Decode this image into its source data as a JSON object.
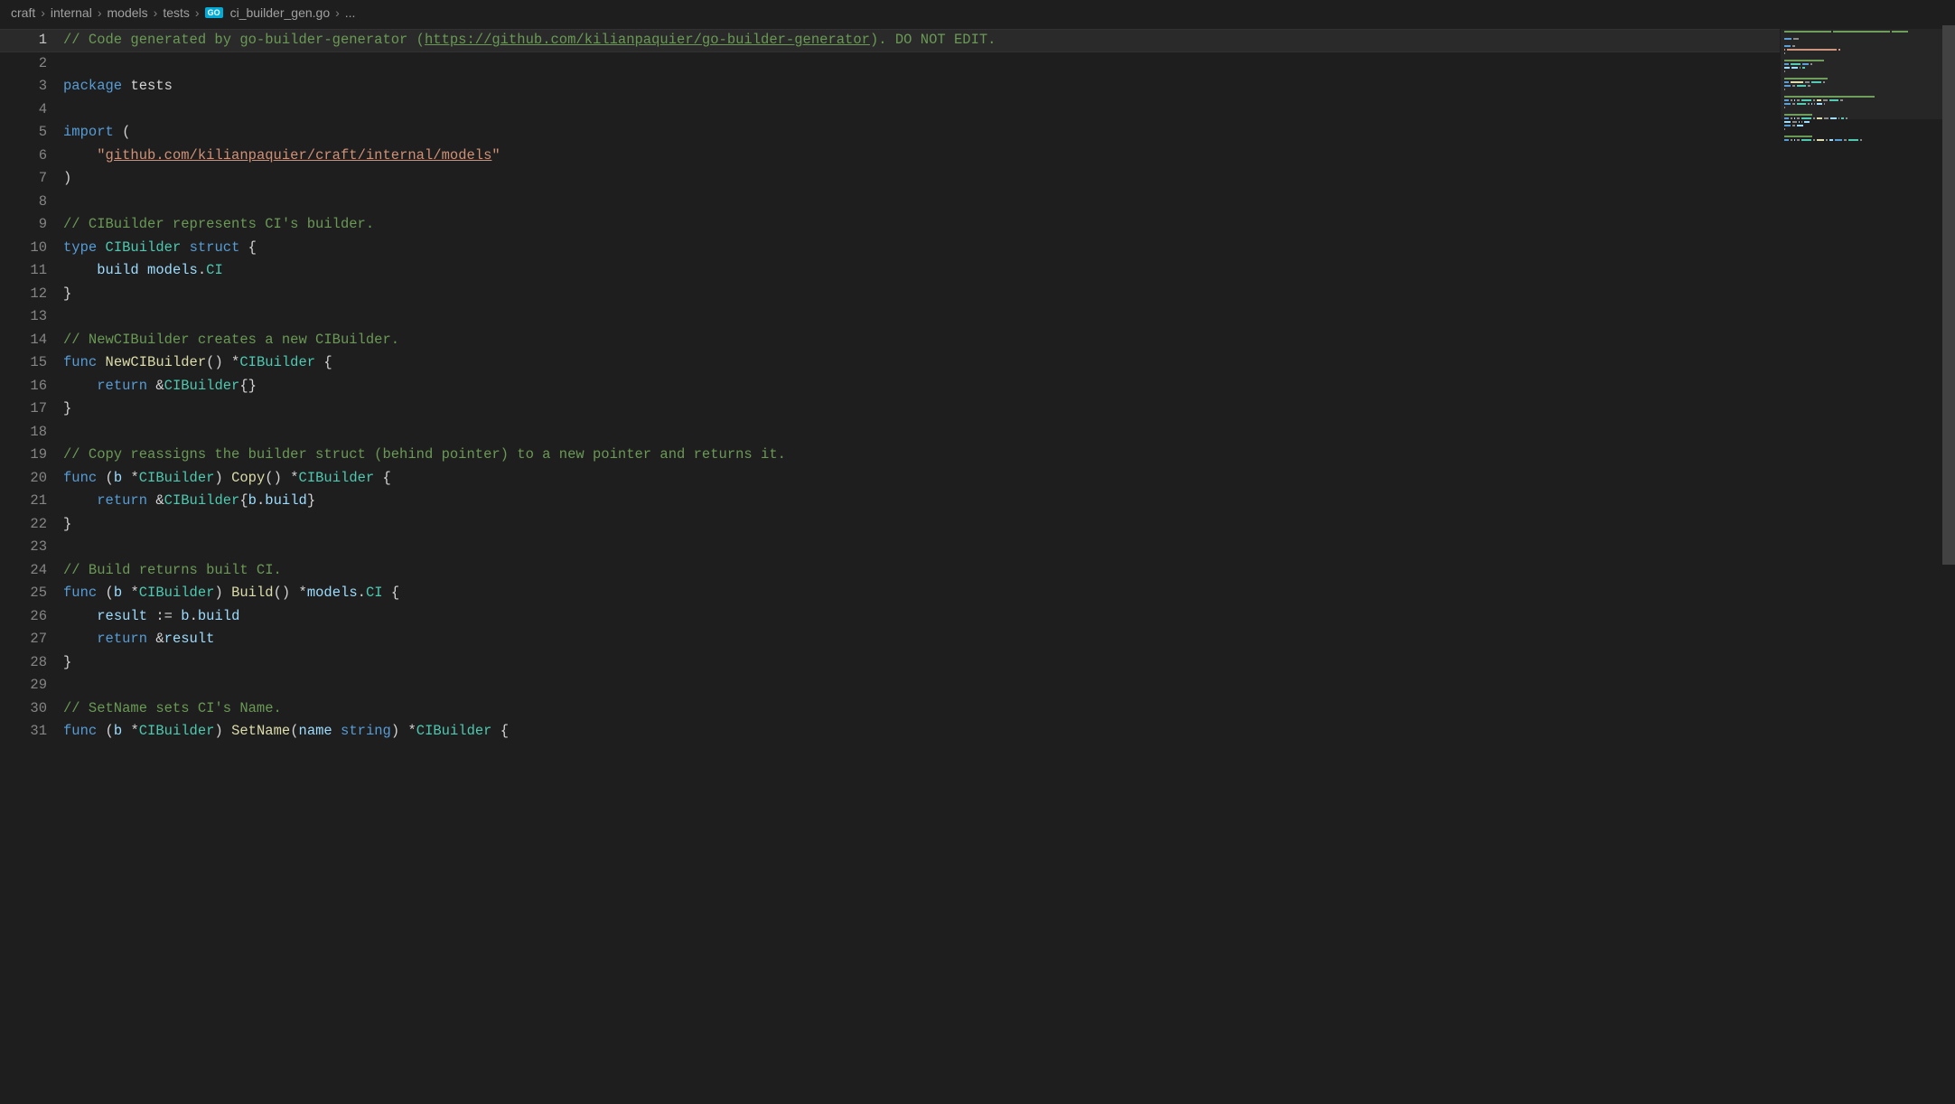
{
  "breadcrumb": {
    "items": [
      "craft",
      "internal",
      "models",
      "tests",
      "ci_builder_gen.go",
      "..."
    ],
    "go_badge": "GO"
  },
  "code": {
    "lines": [
      {
        "n": 1,
        "tokens": [
          {
            "t": "// Code generated by go-builder-generator (",
            "c": "comment"
          },
          {
            "t": "https://github.com/kilianpaquier/go-builder-generator",
            "c": "comment link"
          },
          {
            "t": "). DO NOT EDIT.",
            "c": "comment"
          }
        ]
      },
      {
        "n": 2,
        "tokens": []
      },
      {
        "n": 3,
        "tokens": [
          {
            "t": "package",
            "c": "keyword"
          },
          {
            "t": " ",
            "c": ""
          },
          {
            "t": "tests",
            "c": ""
          }
        ]
      },
      {
        "n": 4,
        "tokens": []
      },
      {
        "n": 5,
        "tokens": [
          {
            "t": "import",
            "c": "keyword"
          },
          {
            "t": " (",
            "c": ""
          }
        ]
      },
      {
        "n": 6,
        "tokens": [
          {
            "t": "    ",
            "c": ""
          },
          {
            "t": "\"",
            "c": "string"
          },
          {
            "t": "github.com/kilianpaquier/craft/internal/models",
            "c": "string link2"
          },
          {
            "t": "\"",
            "c": "string"
          }
        ]
      },
      {
        "n": 7,
        "tokens": [
          {
            "t": ")",
            "c": ""
          }
        ]
      },
      {
        "n": 8,
        "tokens": []
      },
      {
        "n": 9,
        "tokens": [
          {
            "t": "// CIBuilder represents CI's builder.",
            "c": "comment"
          }
        ]
      },
      {
        "n": 10,
        "tokens": [
          {
            "t": "type",
            "c": "keyword"
          },
          {
            "t": " ",
            "c": ""
          },
          {
            "t": "CIBuilder",
            "c": "type"
          },
          {
            "t": " ",
            "c": ""
          },
          {
            "t": "struct",
            "c": "keyword"
          },
          {
            "t": " {",
            "c": ""
          }
        ]
      },
      {
        "n": 11,
        "tokens": [
          {
            "t": "    ",
            "c": ""
          },
          {
            "t": "build",
            "c": "ident"
          },
          {
            "t": " ",
            "c": ""
          },
          {
            "t": "models",
            "c": "ident"
          },
          {
            "t": ".",
            "c": ""
          },
          {
            "t": "CI",
            "c": "type"
          }
        ]
      },
      {
        "n": 12,
        "tokens": [
          {
            "t": "}",
            "c": ""
          }
        ]
      },
      {
        "n": 13,
        "tokens": []
      },
      {
        "n": 14,
        "tokens": [
          {
            "t": "// NewCIBuilder creates a new CIBuilder.",
            "c": "comment"
          }
        ]
      },
      {
        "n": 15,
        "tokens": [
          {
            "t": "func",
            "c": "keyword"
          },
          {
            "t": " ",
            "c": ""
          },
          {
            "t": "NewCIBuilder",
            "c": "func-name"
          },
          {
            "t": "() *",
            "c": ""
          },
          {
            "t": "CIBuilder",
            "c": "type"
          },
          {
            "t": " {",
            "c": ""
          }
        ]
      },
      {
        "n": 16,
        "tokens": [
          {
            "t": "    ",
            "c": ""
          },
          {
            "t": "return",
            "c": "keyword"
          },
          {
            "t": " &",
            "c": ""
          },
          {
            "t": "CIBuilder",
            "c": "type"
          },
          {
            "t": "{}",
            "c": ""
          }
        ]
      },
      {
        "n": 17,
        "tokens": [
          {
            "t": "}",
            "c": ""
          }
        ]
      },
      {
        "n": 18,
        "tokens": []
      },
      {
        "n": 19,
        "tokens": [
          {
            "t": "// Copy reassigns the builder struct (behind pointer) to a new pointer and returns it.",
            "c": "comment"
          }
        ]
      },
      {
        "n": 20,
        "tokens": [
          {
            "t": "func",
            "c": "keyword"
          },
          {
            "t": " (",
            "c": ""
          },
          {
            "t": "b",
            "c": "param"
          },
          {
            "t": " *",
            "c": ""
          },
          {
            "t": "CIBuilder",
            "c": "type"
          },
          {
            "t": ") ",
            "c": ""
          },
          {
            "t": "Copy",
            "c": "func-name"
          },
          {
            "t": "() *",
            "c": ""
          },
          {
            "t": "CIBuilder",
            "c": "type"
          },
          {
            "t": " {",
            "c": ""
          }
        ]
      },
      {
        "n": 21,
        "tokens": [
          {
            "t": "    ",
            "c": ""
          },
          {
            "t": "return",
            "c": "keyword"
          },
          {
            "t": " &",
            "c": ""
          },
          {
            "t": "CIBuilder",
            "c": "type"
          },
          {
            "t": "{",
            "c": ""
          },
          {
            "t": "b",
            "c": "ident"
          },
          {
            "t": ".",
            "c": ""
          },
          {
            "t": "build",
            "c": "ident"
          },
          {
            "t": "}",
            "c": ""
          }
        ]
      },
      {
        "n": 22,
        "tokens": [
          {
            "t": "}",
            "c": ""
          }
        ]
      },
      {
        "n": 23,
        "tokens": []
      },
      {
        "n": 24,
        "tokens": [
          {
            "t": "// Build returns built CI.",
            "c": "comment"
          }
        ]
      },
      {
        "n": 25,
        "tokens": [
          {
            "t": "func",
            "c": "keyword"
          },
          {
            "t": " (",
            "c": ""
          },
          {
            "t": "b",
            "c": "param"
          },
          {
            "t": " *",
            "c": ""
          },
          {
            "t": "CIBuilder",
            "c": "type"
          },
          {
            "t": ") ",
            "c": ""
          },
          {
            "t": "Build",
            "c": "func-name"
          },
          {
            "t": "() *",
            "c": ""
          },
          {
            "t": "models",
            "c": "ident"
          },
          {
            "t": ".",
            "c": ""
          },
          {
            "t": "CI",
            "c": "type"
          },
          {
            "t": " {",
            "c": ""
          }
        ]
      },
      {
        "n": 26,
        "tokens": [
          {
            "t": "    ",
            "c": ""
          },
          {
            "t": "result",
            "c": "ident"
          },
          {
            "t": " := ",
            "c": ""
          },
          {
            "t": "b",
            "c": "ident"
          },
          {
            "t": ".",
            "c": ""
          },
          {
            "t": "build",
            "c": "ident"
          }
        ]
      },
      {
        "n": 27,
        "tokens": [
          {
            "t": "    ",
            "c": ""
          },
          {
            "t": "return",
            "c": "keyword"
          },
          {
            "t": " &",
            "c": ""
          },
          {
            "t": "result",
            "c": "ident"
          }
        ]
      },
      {
        "n": 28,
        "tokens": [
          {
            "t": "}",
            "c": ""
          }
        ]
      },
      {
        "n": 29,
        "tokens": []
      },
      {
        "n": 30,
        "tokens": [
          {
            "t": "// SetName sets CI's Name.",
            "c": "comment"
          }
        ]
      },
      {
        "n": 31,
        "tokens": [
          {
            "t": "func",
            "c": "keyword"
          },
          {
            "t": " (",
            "c": ""
          },
          {
            "t": "b",
            "c": "param"
          },
          {
            "t": " *",
            "c": ""
          },
          {
            "t": "CIBuilder",
            "c": "type"
          },
          {
            "t": ") ",
            "c": ""
          },
          {
            "t": "SetName",
            "c": "func-name"
          },
          {
            "t": "(",
            "c": ""
          },
          {
            "t": "name",
            "c": "param"
          },
          {
            "t": " ",
            "c": ""
          },
          {
            "t": "string",
            "c": "keyword"
          },
          {
            "t": ") *",
            "c": ""
          },
          {
            "t": "CIBuilder",
            "c": "type"
          },
          {
            "t": " {",
            "c": ""
          }
        ]
      }
    ]
  }
}
